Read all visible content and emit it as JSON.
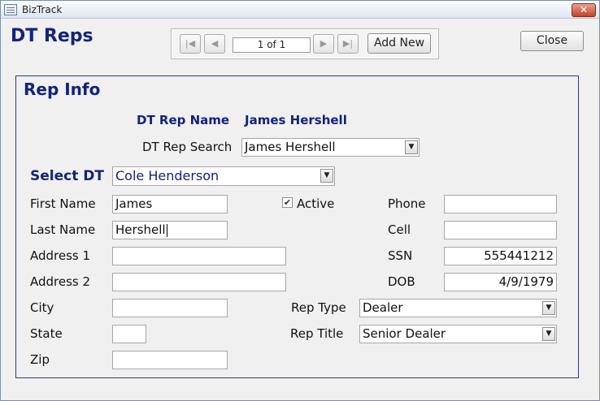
{
  "window": {
    "title": "BizTrack",
    "close_glyph": "✕"
  },
  "form": {
    "title": "DT Reps"
  },
  "nav": {
    "record": "1 of 1",
    "add_new": "Add New",
    "first": "|◀",
    "prev": "◀",
    "next": "▶",
    "last": "▶|"
  },
  "actions": {
    "close": "Close"
  },
  "section": {
    "title": "Rep Info"
  },
  "rep": {
    "name_label": "DT Rep Name",
    "name_value": "James Hershell",
    "search_label": "DT Rep Search",
    "search_value": "James Hershell",
    "select_dt_label": "Select DT",
    "select_dt_value": "Cole Henderson"
  },
  "fields": {
    "first_name": {
      "label": "First Name",
      "value": "James"
    },
    "last_name": {
      "label": "Last Name",
      "value": "Hershell"
    },
    "address1": {
      "label": "Address 1",
      "value": ""
    },
    "address2": {
      "label": "Address 2",
      "value": ""
    },
    "city": {
      "label": "City",
      "value": ""
    },
    "state": {
      "label": "State",
      "value": ""
    },
    "zip": {
      "label": "Zip",
      "value": ""
    },
    "active": {
      "label": "Active",
      "checked": true,
      "glyph": "✔"
    },
    "rep_type": {
      "label": "Rep Type",
      "value": "Dealer"
    },
    "rep_title": {
      "label": "Rep Title",
      "value": "Senior Dealer"
    },
    "phone": {
      "label": "Phone",
      "value": ""
    },
    "cell": {
      "label": "Cell",
      "value": ""
    },
    "ssn": {
      "label": "SSN",
      "value": "555441212"
    },
    "dob": {
      "label": "DOB",
      "value": "4/9/1979"
    }
  },
  "dropdown_glyph": "▼",
  "colors": {
    "title_blue": "#13237a",
    "panel_border": "#2a3a78"
  }
}
